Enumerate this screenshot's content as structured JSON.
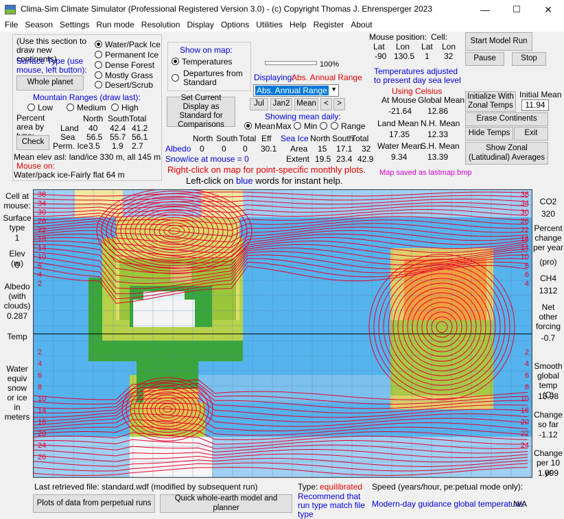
{
  "window": {
    "title": "Clima-Sim Climate Simulator (Professional Registered Version 3.0)   -   (c) Copyright Thomas J. Ehrensperger 2023",
    "min": "—",
    "max": "☐",
    "close": "✕"
  },
  "menu": [
    "File",
    "Season",
    "Settings",
    "Run mode",
    "Resolution",
    "Display",
    "Options",
    "Utilities",
    "Help",
    "Register",
    "About"
  ],
  "draw_section": {
    "hint": "(Use this section to draw new continents)",
    "surface_type": "Surface Type (use mouse, left button):",
    "whole_planet": "Whole planet",
    "surfaces": [
      "Water/Pack Ice",
      "Permanent Ice",
      "Dense Forest",
      "Mostly Grass",
      "Desert/Scrub"
    ],
    "selected_surface": "Water/Pack Ice",
    "mountain_title": "Mountain Ranges (draw last):",
    "mountains": [
      "Low",
      "Medium",
      "High"
    ]
  },
  "percent_area": {
    "label": "Percent area by type:",
    "check": "Check",
    "headers": [
      "North",
      "South",
      "Total"
    ],
    "rows": [
      {
        "name": "Land",
        "north": "40",
        "south": "42.4",
        "total": "41.2"
      },
      {
        "name": "Sea",
        "north": "56.5",
        "south": "55.7",
        "total": "56.1"
      },
      {
        "name": "Perm. Ice",
        "north": "3.5",
        "south": "1.9",
        "total": "2.7"
      }
    ],
    "mean_elev": "Mean elev asl: land/ice  330 m, all  145 m",
    "mouse_on_label": "Mouse on:",
    "mouse_on_value": "Water/pack ice-Fairly flat 64 m"
  },
  "show_on_map": {
    "title": "Show on map:",
    "options": [
      "Temperatures",
      "Departures from Standard"
    ],
    "selected": "Temperatures"
  },
  "set_standard": "Set Current Display as Standard for Comparisons",
  "slider": {
    "value": "100%"
  },
  "displaying": {
    "label": "Displaying:",
    "value": "Abs. Annual Range",
    "combo": "Abs. Annual Range"
  },
  "month_buttons": [
    "Jul",
    "Jan2",
    "Mean",
    "<",
    ">"
  ],
  "showing_mean": {
    "label": "Showing mean daily:",
    "options": [
      "Mean",
      "Max",
      "Min",
      "Range"
    ],
    "selected": "Mean"
  },
  "albedo": {
    "headers": [
      "North",
      "South",
      "Total",
      "Eff"
    ],
    "label": "Albedo",
    "values": [
      "0",
      "0",
      "0",
      "30.1"
    ],
    "snow_ice": "Snow/ice at mouse = 0"
  },
  "sea_ice": {
    "title": "Sea Ice",
    "headers": [
      "North",
      "South",
      "Total"
    ],
    "rows": [
      {
        "name": "Area",
        "north": "15",
        "south": "17.1",
        "total": "32"
      },
      {
        "name": "Extent",
        "north": "19.5",
        "south": "23.4",
        "total": "42.9"
      }
    ]
  },
  "notes": {
    "right_click": "Right-click on map for point-specific monthly plots.",
    "left_click_pre": "Left-click on",
    "left_click_blue": "blue",
    "left_click_post": "words for instant help."
  },
  "mouse_position": {
    "title": "Mouse position:",
    "cell": "Cell:",
    "headers": [
      "Lat",
      "Lon",
      "Lat",
      "Lon"
    ],
    "values": [
      "-90",
      "130.5",
      "1",
      "32"
    ]
  },
  "temps_adjusted": "Temperatures adjusted to present day sea level",
  "using_celsius": "Using Celsius",
  "stats": {
    "at_mouse_label": "At Mouse",
    "at_mouse": "-21.64",
    "global_mean_label": "Global Mean",
    "global_mean": "12.86",
    "land_mean_label": "Land Mean",
    "land_mean": "17.35",
    "nh_mean_label": "N.H. Mean",
    "nh_mean": "12.33",
    "water_mean_label": "Water Mean",
    "water_mean": "9.34",
    "sh_mean_label": "S.H. Mean",
    "sh_mean": "13.39"
  },
  "buttons": {
    "start": "Start Model Run",
    "pause": "Pause",
    "stop": "Stop",
    "init_zonal": "Initialize  With Zonal Temps",
    "initial_mean_label": "Initial Mean",
    "initial_mean_value": "11.94",
    "erase": "Erase Continents",
    "hide_temps": "Hide Temps",
    "exit": "Exit",
    "show_zonal": "Show Zonal (Latitudinal) Averages",
    "plots_perpetual": "Plots of data from perpetual runs",
    "quick_model": "Quick whole-earth model and planner"
  },
  "map_saved": "Map saved as lastmap.bmp",
  "left_panel": {
    "cell_at_mouse": "Cell at mouse:",
    "surface_type": "Surface type",
    "surface_value": "1",
    "elev": "Elev (m)",
    "elev_value": "0",
    "albedo": "Albedo (with clouds)",
    "albedo_value": "0.287",
    "temp": "Temp",
    "water_equiv": "Water equiv snow or ice in meters"
  },
  "right_panel": {
    "co2_label": "CO2",
    "co2": "320",
    "pct_change": "Percent change per year",
    "pct_value": "(pro)",
    "ch4_label": "CH4",
    "ch4": "1312",
    "net_forcing": "Net other forcing",
    "net_value": "-0.7",
    "smooth": "Smooth global temp (C)",
    "smooth_value": "13.98",
    "change_so_far": "Change so far",
    "change_so_far_value": "-1.12",
    "change_per_10": "Change per 10 yr",
    "change_per_10_value": "1.099"
  },
  "contour_labels_left": [
    "38",
    "34",
    "30",
    "26",
    "22",
    "18",
    "14",
    "10",
    "6",
    "4",
    "2",
    "2",
    "4",
    "6",
    "8",
    "10",
    "14",
    "18",
    "20",
    "24",
    "26"
  ],
  "contour_labels_right": [
    "38",
    "34",
    "30",
    "26",
    "22",
    "18",
    "14",
    "10",
    "8",
    "6",
    "4",
    "2",
    "4",
    "6",
    "8",
    "10",
    "16",
    "20",
    "22",
    "24"
  ],
  "footer": {
    "last_file": "Last retrieved file:   standard.wdf (modified by subsequent run)",
    "type_label": "Type:",
    "type_value": "equilibrated",
    "recommend": "Recommend that run type match file type",
    "speed": "Speed (years/hour, pe:petual mode only):",
    "guidance_label": "Modern-day guidance global temperature:",
    "guidance_value": "N/A"
  },
  "colors": {
    "blue_text": "#0000d8",
    "red_text": "#e00000",
    "magenta": "#d000d0",
    "ocean": "#55b3ee",
    "contour": "#e8002a"
  }
}
